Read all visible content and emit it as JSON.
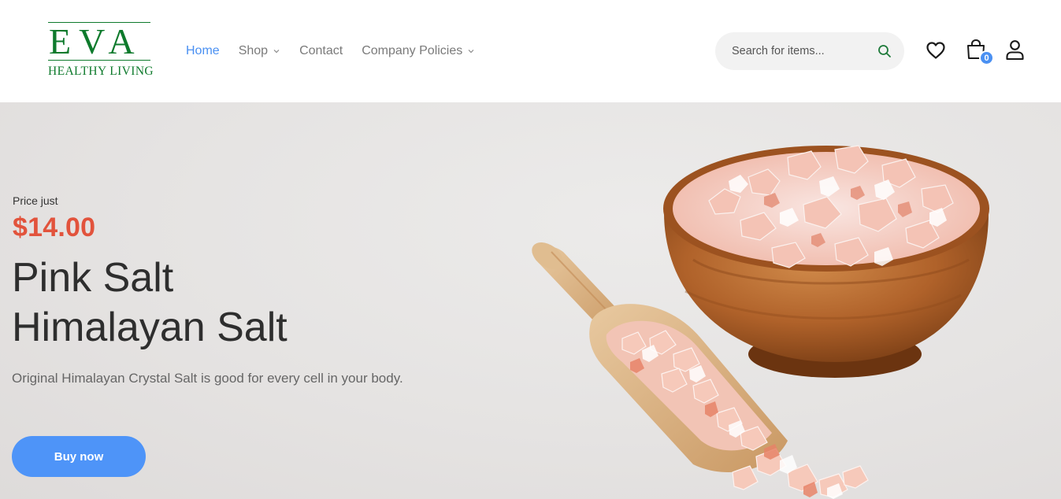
{
  "logo": {
    "brand": "EVA",
    "tagline": "HEALTHY LIVING",
    "color": "#0e7a2c"
  },
  "nav": {
    "items": [
      {
        "label": "Home",
        "active": true,
        "has_dropdown": false
      },
      {
        "label": "Shop",
        "active": false,
        "has_dropdown": true
      },
      {
        "label": "Contact",
        "active": false,
        "has_dropdown": false
      },
      {
        "label": "Company Policies",
        "active": false,
        "has_dropdown": true
      }
    ],
    "active_color": "#4a90f2"
  },
  "search": {
    "placeholder": "Search for items...",
    "icon": "search-icon"
  },
  "header_icons": {
    "wishlist": "heart-icon",
    "cart": "shopping-bag-icon",
    "cart_count": "0",
    "account": "user-icon"
  },
  "hero": {
    "price_label": "Price just",
    "price": "$14.00",
    "title_line1": "Pink Salt",
    "title_line2": "Himalayan Salt",
    "description": "Original Himalayan Crystal Salt is good for every cell in your body.",
    "cta_label": "Buy now",
    "image": "pink-himalayan-salt-bowl-and-scoop",
    "price_color": "#e2533c",
    "cta_color": "#4e94f8"
  }
}
